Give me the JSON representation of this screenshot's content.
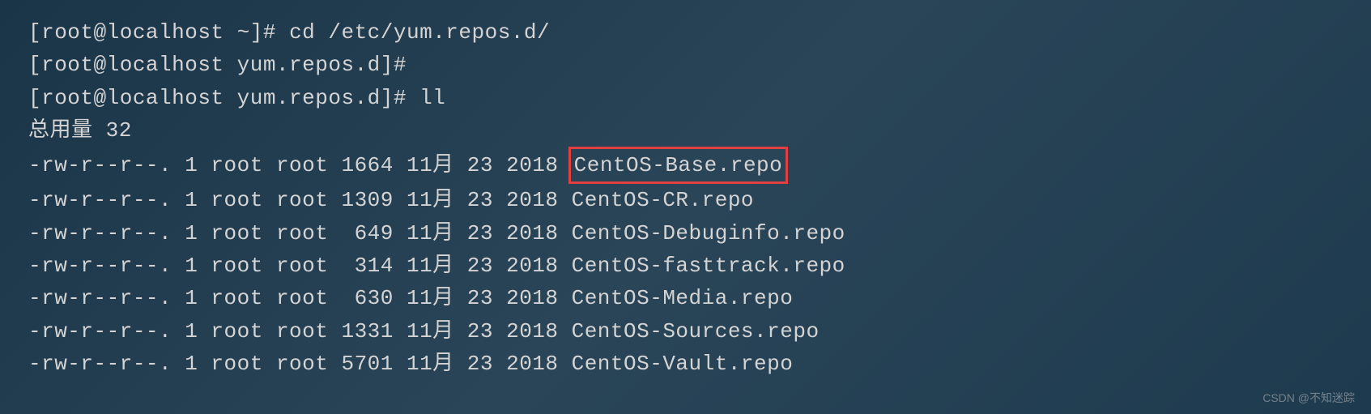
{
  "terminal": {
    "lines": {
      "l1_prompt": "[root@localhost ~]# ",
      "l1_cmd": "cd /etc/yum.repos.d/",
      "l2_prompt": "[root@localhost yum.repos.d]# ",
      "l3_prompt": "[root@localhost yum.repos.d]# ",
      "l3_cmd": "ll",
      "l4_total": "总用量 32",
      "row1_pre": "-rw-r--r--. 1 root root 1664 11月 23 2018 ",
      "row1_file": "CentOS-Base.repo",
      "row2": "-rw-r--r--. 1 root root 1309 11月 23 2018 CentOS-CR.repo",
      "row3": "-rw-r--r--. 1 root root  649 11月 23 2018 CentOS-Debuginfo.repo",
      "row4": "-rw-r--r--. 1 root root  314 11月 23 2018 CentOS-fasttrack.repo",
      "row5": "-rw-r--r--. 1 root root  630 11月 23 2018 CentOS-Media.repo",
      "row6": "-rw-r--r--. 1 root root 1331 11月 23 2018 CentOS-Sources.repo",
      "row7": "-rw-r--r--. 1 root root 5701 11月 23 2018 CentOS-Vault.repo"
    }
  },
  "watermark": "CSDN @不知迷踪",
  "listing": [
    {
      "perms": "-rw-r--r--.",
      "links": 1,
      "owner": "root",
      "group": "root",
      "size": 1664,
      "month": "11月",
      "day": 23,
      "year": 2018,
      "name": "CentOS-Base.repo",
      "highlighted": true
    },
    {
      "perms": "-rw-r--r--.",
      "links": 1,
      "owner": "root",
      "group": "root",
      "size": 1309,
      "month": "11月",
      "day": 23,
      "year": 2018,
      "name": "CentOS-CR.repo",
      "highlighted": false
    },
    {
      "perms": "-rw-r--r--.",
      "links": 1,
      "owner": "root",
      "group": "root",
      "size": 649,
      "month": "11月",
      "day": 23,
      "year": 2018,
      "name": "CentOS-Debuginfo.repo",
      "highlighted": false
    },
    {
      "perms": "-rw-r--r--.",
      "links": 1,
      "owner": "root",
      "group": "root",
      "size": 314,
      "month": "11月",
      "day": 23,
      "year": 2018,
      "name": "CentOS-fasttrack.repo",
      "highlighted": false
    },
    {
      "perms": "-rw-r--r--.",
      "links": 1,
      "owner": "root",
      "group": "root",
      "size": 630,
      "month": "11月",
      "day": 23,
      "year": 2018,
      "name": "CentOS-Media.repo",
      "highlighted": false
    },
    {
      "perms": "-rw-r--r--.",
      "links": 1,
      "owner": "root",
      "group": "root",
      "size": 1331,
      "month": "11月",
      "day": 23,
      "year": 2018,
      "name": "CentOS-Sources.repo",
      "highlighted": false
    },
    {
      "perms": "-rw-r--r--.",
      "links": 1,
      "owner": "root",
      "group": "root",
      "size": 5701,
      "month": "11月",
      "day": 23,
      "year": 2018,
      "name": "CentOS-Vault.repo",
      "highlighted": false
    }
  ]
}
